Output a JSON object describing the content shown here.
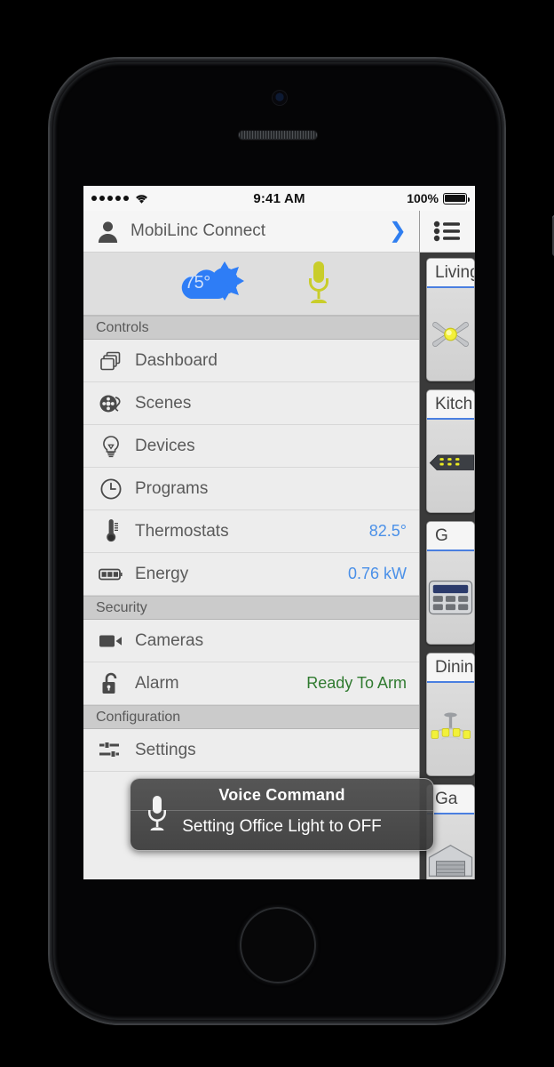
{
  "device": {
    "name": "iphone-5s-black",
    "home_button": "home-button"
  },
  "status_bar": {
    "signal_icon": "signal-dots-icon",
    "wifi_icon": "wifi-icon",
    "time": "9:41 AM",
    "battery_percent": "100%",
    "battery_icon": "battery-full-icon"
  },
  "account": {
    "avatar_icon": "person-icon",
    "name": "MobiLinc Connect",
    "chevron_icon": "chevron-right-icon",
    "chevron_color": "#2f7ef0"
  },
  "weather_bar": {
    "weather_icon": "partly-cloudy-icon",
    "temperature": "75°",
    "weather_color": "#2e7df6",
    "mic_icon": "microphone-icon",
    "mic_color": "#c9cd2a"
  },
  "menu": {
    "sections": [
      {
        "title": "Controls",
        "items": [
          {
            "label": "Dashboard",
            "icon": "windows-stack-icon",
            "value": ""
          },
          {
            "label": "Scenes",
            "icon": "film-reel-icon",
            "value": ""
          },
          {
            "label": "Devices",
            "icon": "light-bulb-icon",
            "value": ""
          },
          {
            "label": "Programs",
            "icon": "clock-icon",
            "value": ""
          },
          {
            "label": "Thermostats",
            "icon": "thermometer-icon",
            "value": "82.5°"
          },
          {
            "label": "Energy",
            "icon": "battery-icon",
            "value": "0.76 kW"
          }
        ]
      },
      {
        "title": "Security",
        "items": [
          {
            "label": "Cameras",
            "icon": "video-camera-icon",
            "value": ""
          },
          {
            "label": "Alarm",
            "icon": "padlock-open-icon",
            "value": "Ready To Arm"
          }
        ]
      },
      {
        "title": "Configuration",
        "items": [
          {
            "label": "Settings",
            "icon": "sliders-icon",
            "value": ""
          }
        ]
      }
    ],
    "value_color": "#4a90e8",
    "alarm_status_color": "#2f7a2f"
  },
  "dashboard": {
    "list_icon": "list-menu-icon",
    "cards": [
      {
        "title": "Living",
        "icon": "ceiling-fan-icon"
      },
      {
        "title": "Kitch",
        "icon": "under-cabinet-light-icon"
      },
      {
        "title": "G",
        "icon": "keypad-icon"
      },
      {
        "title": "Dinin",
        "icon": "chandelier-icon"
      },
      {
        "title": "Ga",
        "icon": "garage-icon"
      }
    ],
    "accent_color": "#4a7fe0"
  },
  "voice_overlay": {
    "mic_icon": "microphone-icon",
    "title": "Voice Command",
    "message": "Setting Office Light to OFF"
  }
}
